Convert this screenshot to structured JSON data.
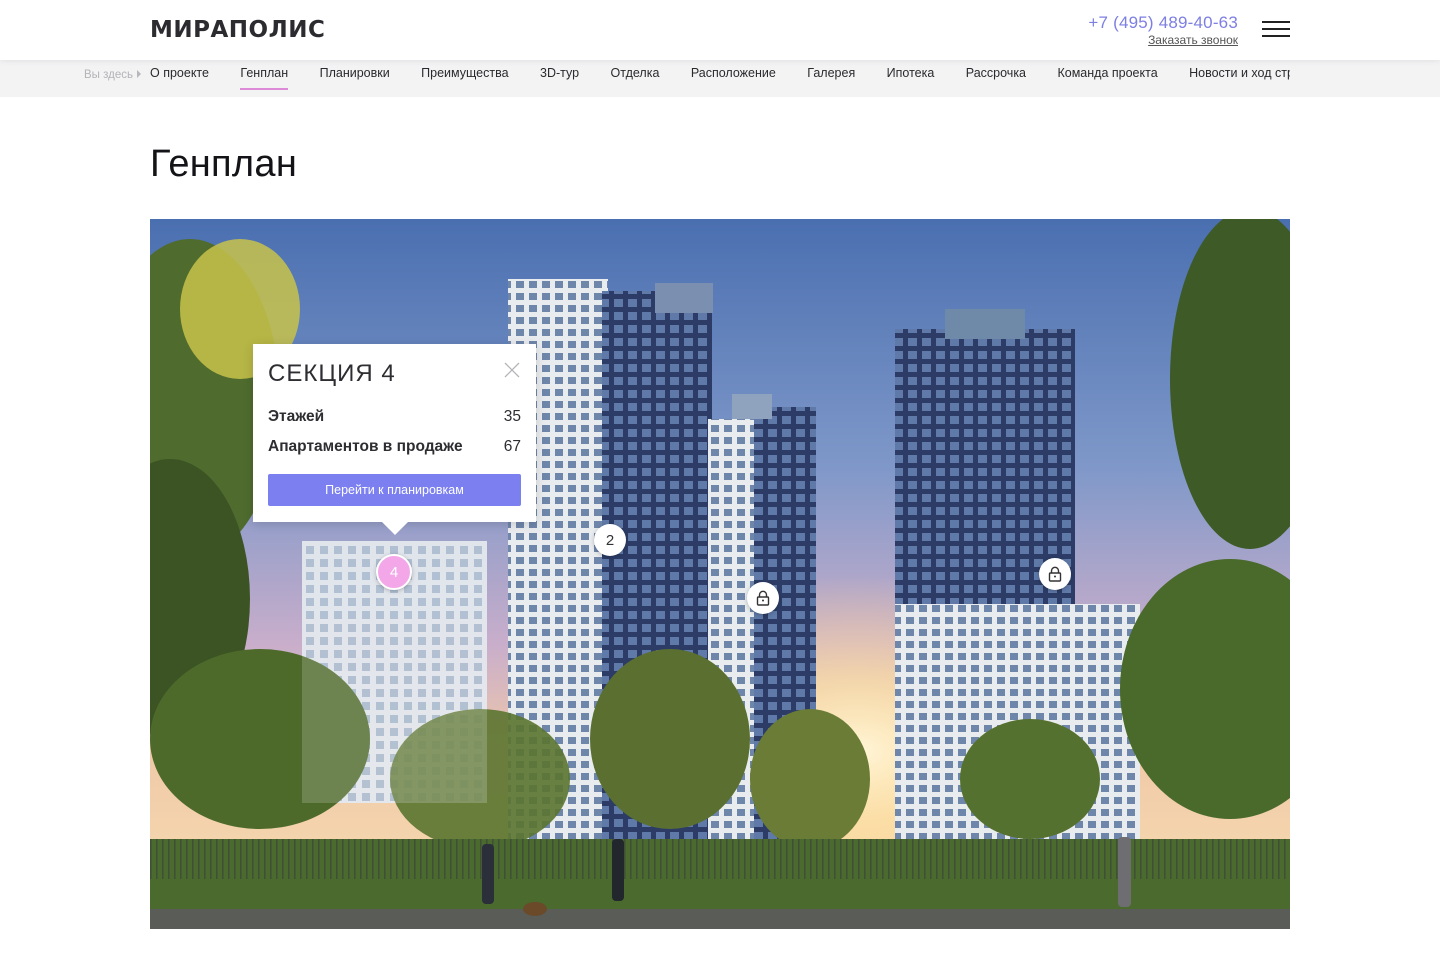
{
  "header": {
    "logo": "МИРАПОЛИС",
    "phone": "+7 (495) 489-40-63",
    "callback": "Заказать звонок",
    "menu_icon": "burger-menu-icon"
  },
  "breadcrumb": {
    "prefix": "Вы здесь"
  },
  "nav": {
    "items": [
      {
        "label": "О проекте"
      },
      {
        "label": "Генплан"
      },
      {
        "label": "Планировки"
      },
      {
        "label": "Преимущества"
      },
      {
        "label": "3D-тур"
      },
      {
        "label": "Отделка"
      },
      {
        "label": "Расположение"
      },
      {
        "label": "Галерея"
      },
      {
        "label": "Ипотека"
      },
      {
        "label": "Рассрочка"
      },
      {
        "label": "Команда проекта"
      },
      {
        "label": "Новости и ход строительства"
      }
    ],
    "active_index": 1
  },
  "page": {
    "title": "Генплан"
  },
  "markers": {
    "section4": "4",
    "section2": "2",
    "locked_icon": "lock-icon"
  },
  "popup": {
    "title": "СЕКЦИЯ 4",
    "floors_label": "Этажей",
    "floors_value": "35",
    "apartments_label": "Апартаментов в продаже",
    "apartments_value": "67",
    "button": "Перейти к планировкам"
  },
  "colors": {
    "accent": "#7b7ff0",
    "phone": "#7d7fe2",
    "active_underline": "#dd8bd8",
    "marker_active": "#f3a7e8"
  }
}
